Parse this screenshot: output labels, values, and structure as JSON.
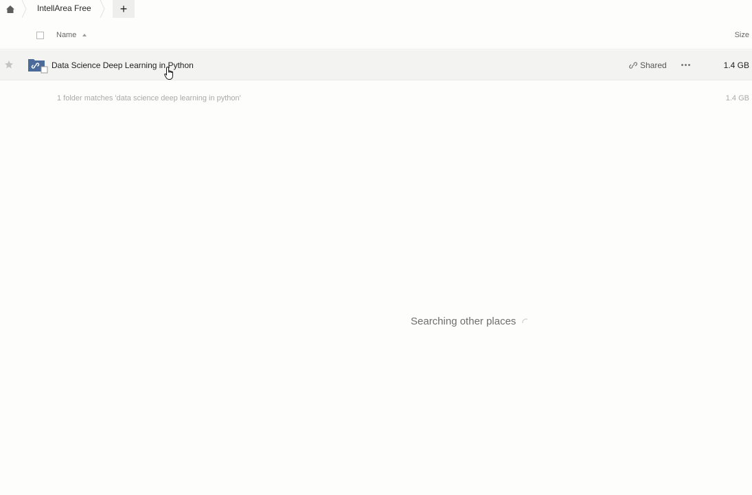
{
  "breadcrumb": {
    "home_icon": "home-icon",
    "items": [
      {
        "label": "IntellArea Free"
      }
    ],
    "add_label": "+"
  },
  "header": {
    "name_label": "Name",
    "sort_icon": "sort-ascending-icon",
    "size_label": "Size"
  },
  "rows": [
    {
      "name": "Data Science Deep Learning in Python",
      "type_icon": "shared-folder-icon",
      "star_icon": "star-icon",
      "shared_label": "Shared",
      "shared_icon": "link-icon",
      "more_icon": "more-icon",
      "size": "1.4 GB"
    }
  ],
  "summary": {
    "text": "1 folder matches 'data science deep learning in python'",
    "size": "1.4 GB"
  },
  "status": {
    "searching_text": "Searching other places"
  },
  "colors": {
    "background": "#fdfdfc",
    "row_highlight": "#f3f3f2",
    "folder_blue": "#4a6b9a",
    "muted_text": "#a9a9a9"
  }
}
